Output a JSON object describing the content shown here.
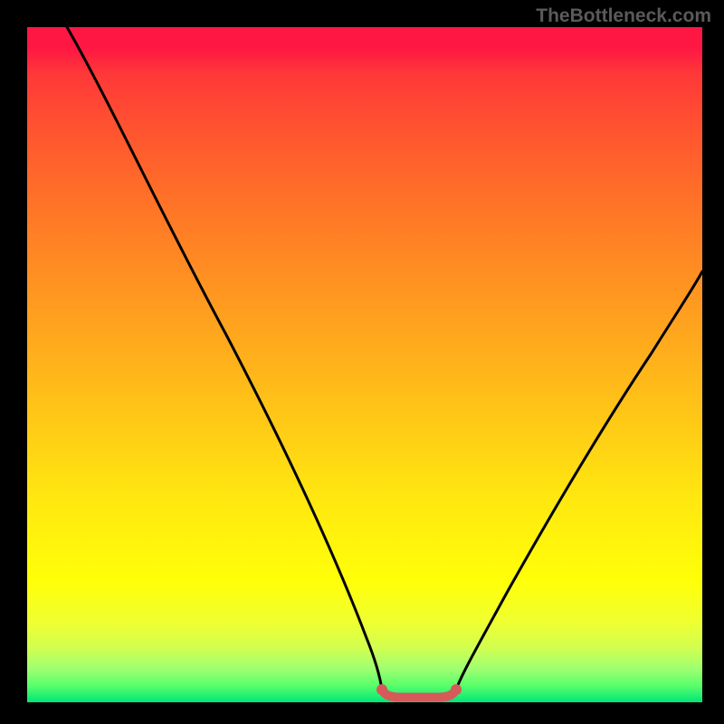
{
  "watermark": "TheBottleneck.com",
  "chart_data": {
    "type": "line",
    "title": "",
    "xlabel": "",
    "ylabel": "",
    "xlim": [
      0,
      100
    ],
    "ylim": [
      0,
      100
    ],
    "grid": false,
    "series": [
      {
        "name": "left-curve",
        "x": [
          6,
          10,
          15,
          20,
          25,
          30,
          35,
          40,
          45,
          50,
          52.5
        ],
        "values": [
          100,
          93,
          84,
          74,
          64,
          53,
          41.5,
          29,
          16,
          4,
          1.8
        ]
      },
      {
        "name": "right-curve",
        "x": [
          63.5,
          66,
          70,
          75,
          80,
          85,
          90,
          95,
          100
        ],
        "values": [
          1.8,
          2.5,
          5,
          10,
          18,
          28,
          39,
          51,
          64
        ]
      },
      {
        "name": "flat-bottom-highlight",
        "x": [
          52.5,
          54,
          56,
          58,
          60,
          62,
          63.5
        ],
        "values": [
          1.8,
          1.2,
          0.9,
          0.9,
          0.9,
          1.2,
          1.8
        ]
      }
    ],
    "gradient": {
      "top_color": "#ff1744",
      "mid_color": "#ffe810",
      "bottom_color": "#00e676"
    },
    "highlight_color": "#d65a5a"
  }
}
